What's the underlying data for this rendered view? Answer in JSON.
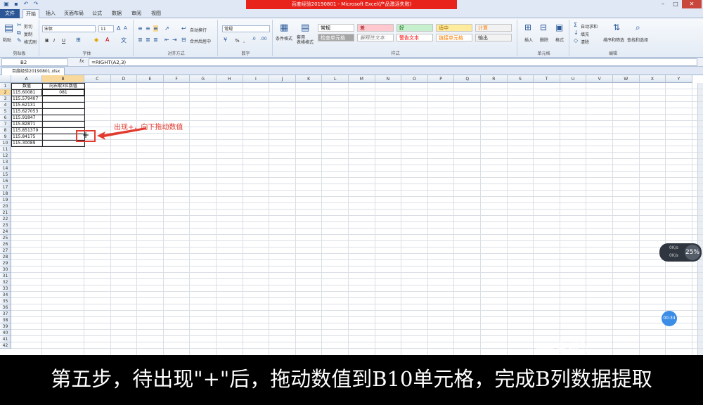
{
  "window": {
    "title": "百度经验20190801 - Microsoft Excel(产品激活失败)",
    "minimize": "–",
    "maximize": "□",
    "close": "✕"
  },
  "ribbon_tabs": [
    "文件",
    "开始",
    "插入",
    "页面布局",
    "公式",
    "数据",
    "审阅",
    "视图"
  ],
  "ribbon": {
    "clipboard": {
      "label": "剪贴板",
      "paste": "粘贴",
      "cut": "剪切",
      "copy": "复制",
      "format_painter": "格式刷"
    },
    "font": {
      "label": "字体",
      "font_name": "宋体",
      "font_size": "11",
      "bold": "B",
      "italic": "I",
      "underline": "U"
    },
    "alignment": {
      "label": "对齐方式",
      "wrap": "自动换行",
      "merge": "合并后居中"
    },
    "number": {
      "label": "数字",
      "format": "常规",
      "percent": "%",
      "comma": ","
    },
    "styles": {
      "label": "样式",
      "cond_format": "条件格式",
      "table_format": "套用\n表格格式",
      "items": [
        {
          "text": "常规",
          "bg": "#ffffff",
          "fg": "#000000"
        },
        {
          "text": "差",
          "bg": "#ffc7ce",
          "fg": "#9c0006"
        },
        {
          "text": "好",
          "bg": "#c6efce",
          "fg": "#006100"
        },
        {
          "text": "适中",
          "bg": "#ffeb9c",
          "fg": "#9c6500"
        },
        {
          "text": "计算",
          "bg": "#f2f2f2",
          "fg": "#fa7d00"
        },
        {
          "text": "检查单元格",
          "bg": "#a5a5a5",
          "fg": "#ffffff"
        },
        {
          "text": "解释性文本",
          "bg": "#ffffff",
          "fg": "#7f7f7f"
        },
        {
          "text": "警告文本",
          "bg": "#ffffff",
          "fg": "#ff0000"
        },
        {
          "text": "链接单元格",
          "bg": "#ffffff",
          "fg": "#fa7d00"
        },
        {
          "text": "输出",
          "bg": "#f2f2f2",
          "fg": "#3f3f3f"
        }
      ]
    },
    "cells": {
      "label": "单元格",
      "insert": "插入",
      "delete": "删除",
      "format": "格式"
    },
    "editing": {
      "label": "编辑",
      "autosum": "自动求和",
      "fill": "填充",
      "clear": "清除",
      "sort_filter": "排序和筛选",
      "find_select": "查找和选择"
    }
  },
  "formula_bar": {
    "name_box": "B2",
    "fx": "fx",
    "formula": "=RIGHT(A2,3)"
  },
  "workbook_tab": "百度经验20190801.xlsx",
  "sheet": {
    "columns": [
      "A",
      "B",
      "C",
      "D",
      "E",
      "F",
      "G",
      "H",
      "I",
      "J",
      "K",
      "L",
      "M",
      "N",
      "O",
      "P",
      "Q",
      "R",
      "S",
      "T",
      "U",
      "V",
      "W",
      "X",
      "Y"
    ],
    "rows": [
      "1",
      "2",
      "3",
      "4",
      "5",
      "6",
      "7",
      "8",
      "9",
      "10",
      "11",
      "12",
      "13",
      "14",
      "15",
      "16",
      "17",
      "18",
      "19",
      "20",
      "21",
      "22",
      "23",
      "24",
      "25",
      "26",
      "27",
      "28",
      "29",
      "30",
      "31",
      "32",
      "33",
      "34",
      "35",
      "36",
      "37",
      "38",
      "39",
      "40",
      "41",
      "42"
    ],
    "header_a": "数值",
    "header_b": "向右取3位数值",
    "values_a": [
      "115.60081",
      "115.579407",
      "115.62131",
      "115.627053",
      "115.91847",
      "115.82871",
      "115.851379",
      "115.84175",
      "115.30089"
    ],
    "b2": "081"
  },
  "annotation": "出现+，向下拖动数值",
  "widget": {
    "percent": "25%",
    "line1": "0K/s",
    "line2": "0K/s",
    "timer": "00:34"
  },
  "subtitle": "第五步，待出现\"+\"后，拖动数值到B10单元格，完成B列数据提取",
  "watermark": "经验"
}
